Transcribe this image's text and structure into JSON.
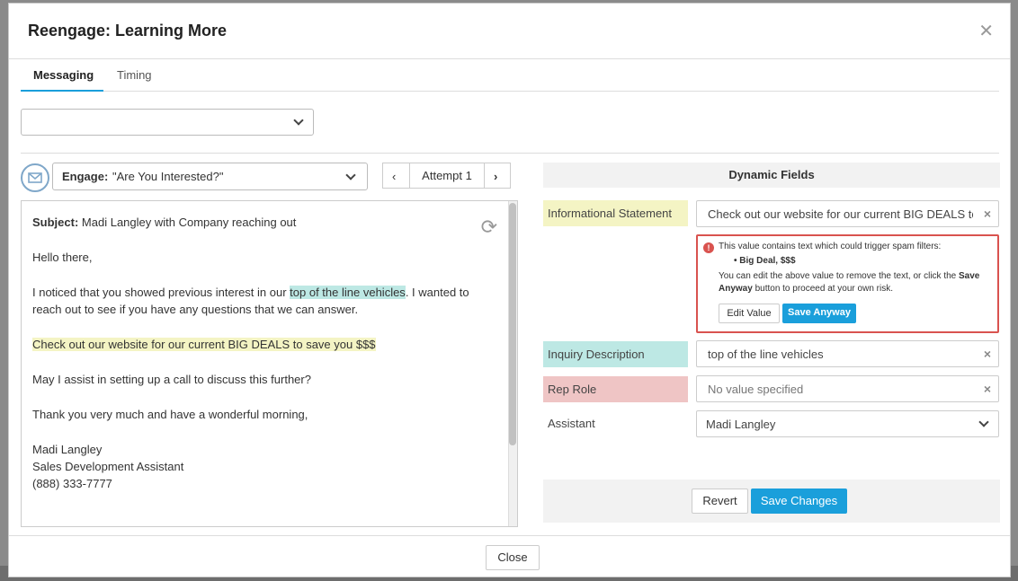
{
  "modal": {
    "title": "Reengage: Learning More"
  },
  "tabs": [
    {
      "label": "Messaging"
    },
    {
      "label": "Timing"
    }
  ],
  "template_select": {
    "value": ""
  },
  "engage": {
    "label": "Engage:",
    "value": "\"Are You Interested?\""
  },
  "attempt": {
    "label": "Attempt 1",
    "prev": "‹",
    "next": "›"
  },
  "email": {
    "subject_label": "Subject:",
    "subject": "Madi Langley with Company reaching out",
    "greeting": "Hello there,",
    "line1_pre": "I noticed that you showed previous interest in our ",
    "line1_hl": "top of the line vehicles",
    "line1_post": ". I wanted to",
    "line2": "reach out to see if you have any questions that we can answer.",
    "statement": "Check out our website for our current BIG DEALS to save you $$$",
    "question": "May I assist in setting up a call to discuss this further?",
    "thanks": "Thank you very much and have a wonderful morning,",
    "sig_name": "Madi Langley",
    "sig_title": "Sales Development Assistant",
    "sig_phone": "(888) 333-7777"
  },
  "dynamic_fields": {
    "header": "Dynamic Fields",
    "informational": {
      "label": "Informational Statement",
      "value": "Check out our website for our current BIG DEALS to save you $$$"
    },
    "warning": {
      "line1": "This value contains text which could trigger spam filters:",
      "bullet": "Big Deal, $$$",
      "line2_a": "You can edit the above value to remove the text, or click the ",
      "line2_b": "Save",
      "line3_a": "Anyway",
      "line3_b": " button to proceed at your own risk.",
      "edit_label": "Edit Value",
      "save_anyway_label": "Save Anyway"
    },
    "inquiry": {
      "label": "Inquiry Description",
      "value": "top of the line vehicles"
    },
    "rep_role": {
      "label": "Rep Role",
      "placeholder": "No value specified"
    },
    "assistant": {
      "label": "Assistant",
      "value": "Madi Langley"
    }
  },
  "actions": {
    "revert": "Revert",
    "save": "Save Changes",
    "close": "Close"
  },
  "icons": {
    "mail": "mail-icon",
    "refresh": "refresh-icon",
    "close": "close-icon",
    "warning": "warning-icon"
  },
  "colors": {
    "accent": "#1a9fdb",
    "teal": "#bde8e4",
    "yellow": "#f4f4c4",
    "pink": "#efc5c5",
    "error": "#d9534f"
  }
}
